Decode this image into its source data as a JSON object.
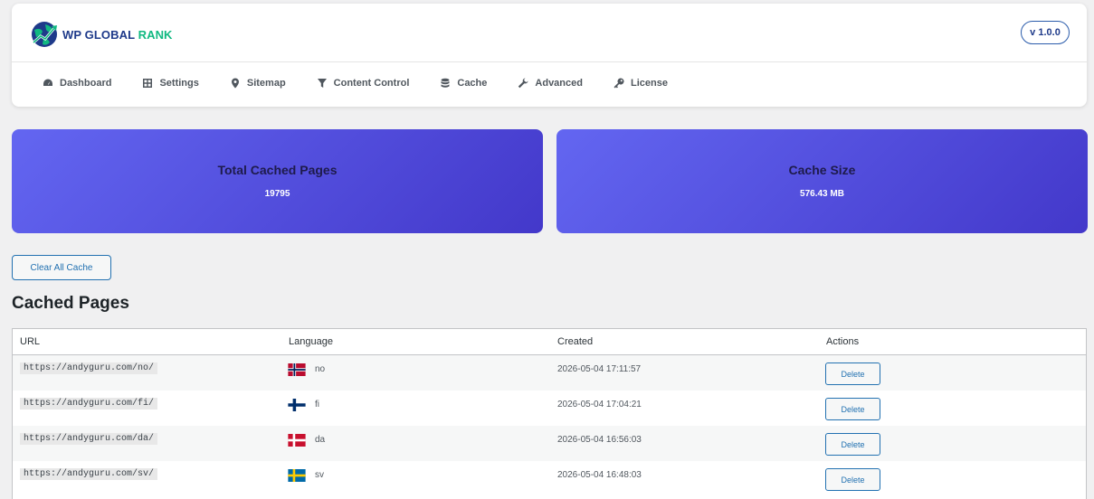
{
  "brand": {
    "word1": "WP",
    "word2": "GLOBAL",
    "word3": "RANK"
  },
  "version": "v 1.0.0",
  "nav": [
    {
      "label": "Dashboard",
      "icon": "dashboard-icon"
    },
    {
      "label": "Settings",
      "icon": "settings-grid-icon"
    },
    {
      "label": "Sitemap",
      "icon": "map-pin-icon"
    },
    {
      "label": "Content Control",
      "icon": "filter-icon"
    },
    {
      "label": "Cache",
      "icon": "database-icon"
    },
    {
      "label": "Advanced",
      "icon": "wrench-icon"
    },
    {
      "label": "License",
      "icon": "key-icon"
    }
  ],
  "stats": {
    "total_pages": {
      "title": "Total Cached Pages",
      "value": "19795"
    },
    "cache_size": {
      "title": "Cache Size",
      "value": "576.43 MB"
    }
  },
  "clear_button": "Clear All Cache",
  "section_title": "Cached Pages",
  "table": {
    "headers": [
      "URL",
      "Language",
      "Created",
      "Actions"
    ],
    "delete_label": "Delete",
    "rows": [
      {
        "url": "https://andyguru.com/no/",
        "lang": "no",
        "flag": "norway-flag-icon",
        "created": "2026-05-04 17:11:57"
      },
      {
        "url": "https://andyguru.com/fi/",
        "lang": "fi",
        "flag": "finland-flag-icon",
        "created": "2026-05-04 17:04:21"
      },
      {
        "url": "https://andyguru.com/da/",
        "lang": "da",
        "flag": "denmark-flag-icon",
        "created": "2026-05-04 16:56:03"
      },
      {
        "url": "https://andyguru.com/sv/",
        "lang": "sv",
        "flag": "sweden-flag-icon",
        "created": "2026-05-04 16:48:03"
      }
    ]
  },
  "colors": {
    "accent": "#2271b1",
    "card_start": "#6366f1",
    "card_end": "#4338ca",
    "brand_blue": "#1e3a8a",
    "brand_green": "#10b981"
  }
}
